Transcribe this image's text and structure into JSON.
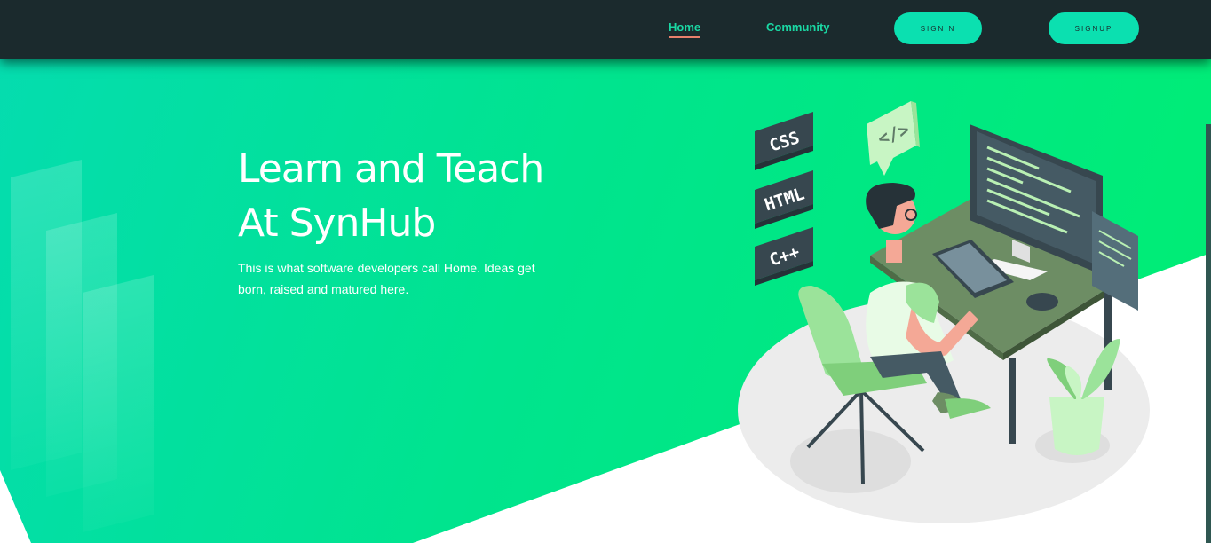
{
  "nav": {
    "links": [
      {
        "label": "Home",
        "active": true
      },
      {
        "label": "Community",
        "active": false
      }
    ],
    "signin_label": "SIGNIN",
    "signup_label": "SIGNUP"
  },
  "hero": {
    "title_line1": "Learn and Teach",
    "title_line2": "At SynHub",
    "subtitle": "This is what software developers call Home. Ideas get born, raised and matured here."
  },
  "illustration": {
    "tags": [
      "CSS",
      "HTML",
      "C++"
    ],
    "code_bubble": "</>"
  },
  "colors": {
    "nav_bg": "#1b2a2d",
    "accent": "#1ad7a3",
    "button_bg": "#0be0b0",
    "active_underline": "#e9806c",
    "hero_gradient_start": "#05dcb0",
    "hero_gradient_end": "#00ee72"
  }
}
